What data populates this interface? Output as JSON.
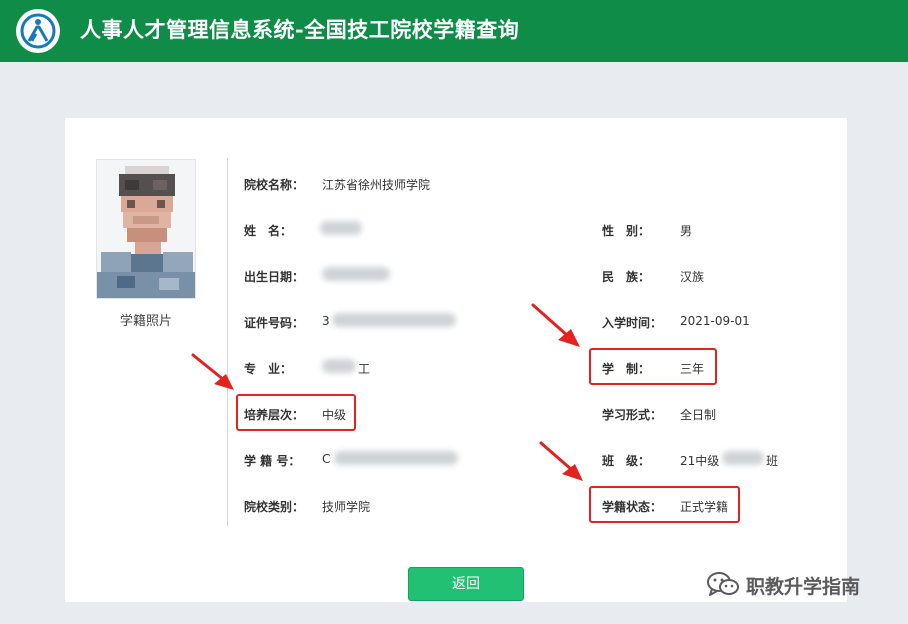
{
  "header": {
    "title": "人事人才管理信息系统-全国技工院校学籍查询"
  },
  "photo": {
    "caption": "学籍照片"
  },
  "fields": {
    "school_name": {
      "label": "院校名称：",
      "value": "江苏省徐州技师学院"
    },
    "name": {
      "label": "姓　名：",
      "value": ""
    },
    "gender": {
      "label": "性　别：",
      "value": "男"
    },
    "birth": {
      "label": "出生日期：",
      "value": ""
    },
    "ethnicity": {
      "label": "民　族：",
      "value": "汉族"
    },
    "id_number": {
      "label": "证件号码：",
      "value": "3"
    },
    "enroll_time": {
      "label": "入学时间：",
      "value": "2021-09-01"
    },
    "major": {
      "label": "专　业：",
      "value": "工"
    },
    "duration": {
      "label": "学　制：",
      "value": "三年"
    },
    "level": {
      "label": "培养层次：",
      "value": "中级"
    },
    "study_form": {
      "label": "学习形式：",
      "value": "全日制"
    },
    "student_no": {
      "label": "学 籍 号：",
      "value": "C"
    },
    "class": {
      "label": "班　级：",
      "value": "21中级",
      "suffix": "班"
    },
    "school_type": {
      "label": "院校类别：",
      "value": "技师学院"
    },
    "status": {
      "label": "学籍状态：",
      "value": "正式学籍"
    }
  },
  "buttons": {
    "back": "返回"
  },
  "watermark": {
    "text": "职教升学指南"
  },
  "colors": {
    "header": "#0f8c48",
    "button": "#21c073",
    "highlight": "#e3231d"
  }
}
